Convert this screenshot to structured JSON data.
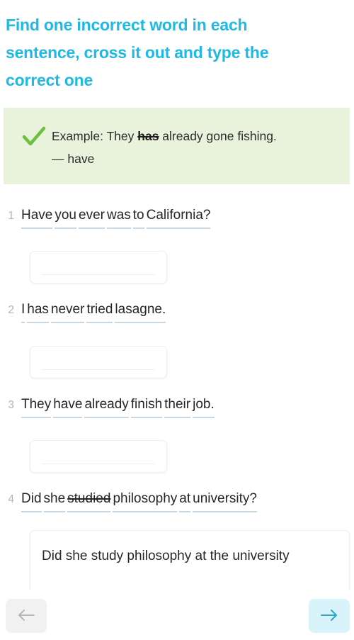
{
  "colors": {
    "title": "#1fb9e3",
    "example_bg": "#e9f2db",
    "check": "#6cbf3f",
    "word_underline": "#c8d7e2",
    "next_bg": "#d9f3fb",
    "next_arrow": "#2aa9c9",
    "prev_bg": "#f1f1f1",
    "prev_arrow": "#b0b0b0"
  },
  "title": "Find one incorrect word in each sentence, cross it out and type the correct one",
  "example": {
    "icon": "check-icon",
    "prefix": "Example: They ",
    "struck_word": "has",
    "suffix": " already gone fishing.",
    "correction": "— have"
  },
  "questions": [
    {
      "number": "1",
      "words": [
        {
          "text": "Have",
          "crossed": false
        },
        {
          "text": "you",
          "crossed": false
        },
        {
          "text": "ever",
          "crossed": false
        },
        {
          "text": "was",
          "crossed": false
        },
        {
          "text": "to",
          "crossed": false
        },
        {
          "text": "California?",
          "crossed": false
        }
      ],
      "answer": "",
      "answer_placeholder": "",
      "answer_width": "small"
    },
    {
      "number": "2",
      "words": [
        {
          "text": "I",
          "crossed": false
        },
        {
          "text": "has",
          "crossed": false
        },
        {
          "text": "never",
          "crossed": false
        },
        {
          "text": "tried",
          "crossed": false
        },
        {
          "text": "lasagne.",
          "crossed": false
        }
      ],
      "answer": "",
      "answer_placeholder": "",
      "answer_width": "small"
    },
    {
      "number": "3",
      "words": [
        {
          "text": "They",
          "crossed": false
        },
        {
          "text": "have",
          "crossed": false
        },
        {
          "text": "already",
          "crossed": false
        },
        {
          "text": "finish",
          "crossed": false
        },
        {
          "text": "their",
          "crossed": false
        },
        {
          "text": "job.",
          "crossed": false
        }
      ],
      "answer": "",
      "answer_placeholder": "",
      "answer_width": "small"
    },
    {
      "number": "4",
      "words": [
        {
          "text": "Did",
          "crossed": false
        },
        {
          "text": "she",
          "crossed": false
        },
        {
          "text": "studied",
          "crossed": true
        },
        {
          "text": "philosophy",
          "crossed": false
        },
        {
          "text": "at",
          "crossed": false
        },
        {
          "text": "university?",
          "crossed": false
        }
      ],
      "answer": "Did she study philosophy  at the university",
      "answer_placeholder": "",
      "answer_width": "wide"
    }
  ],
  "nav": {
    "prev_icon": "arrow-left-icon",
    "next_icon": "arrow-right-icon",
    "prev_label": "",
    "next_label": ""
  }
}
